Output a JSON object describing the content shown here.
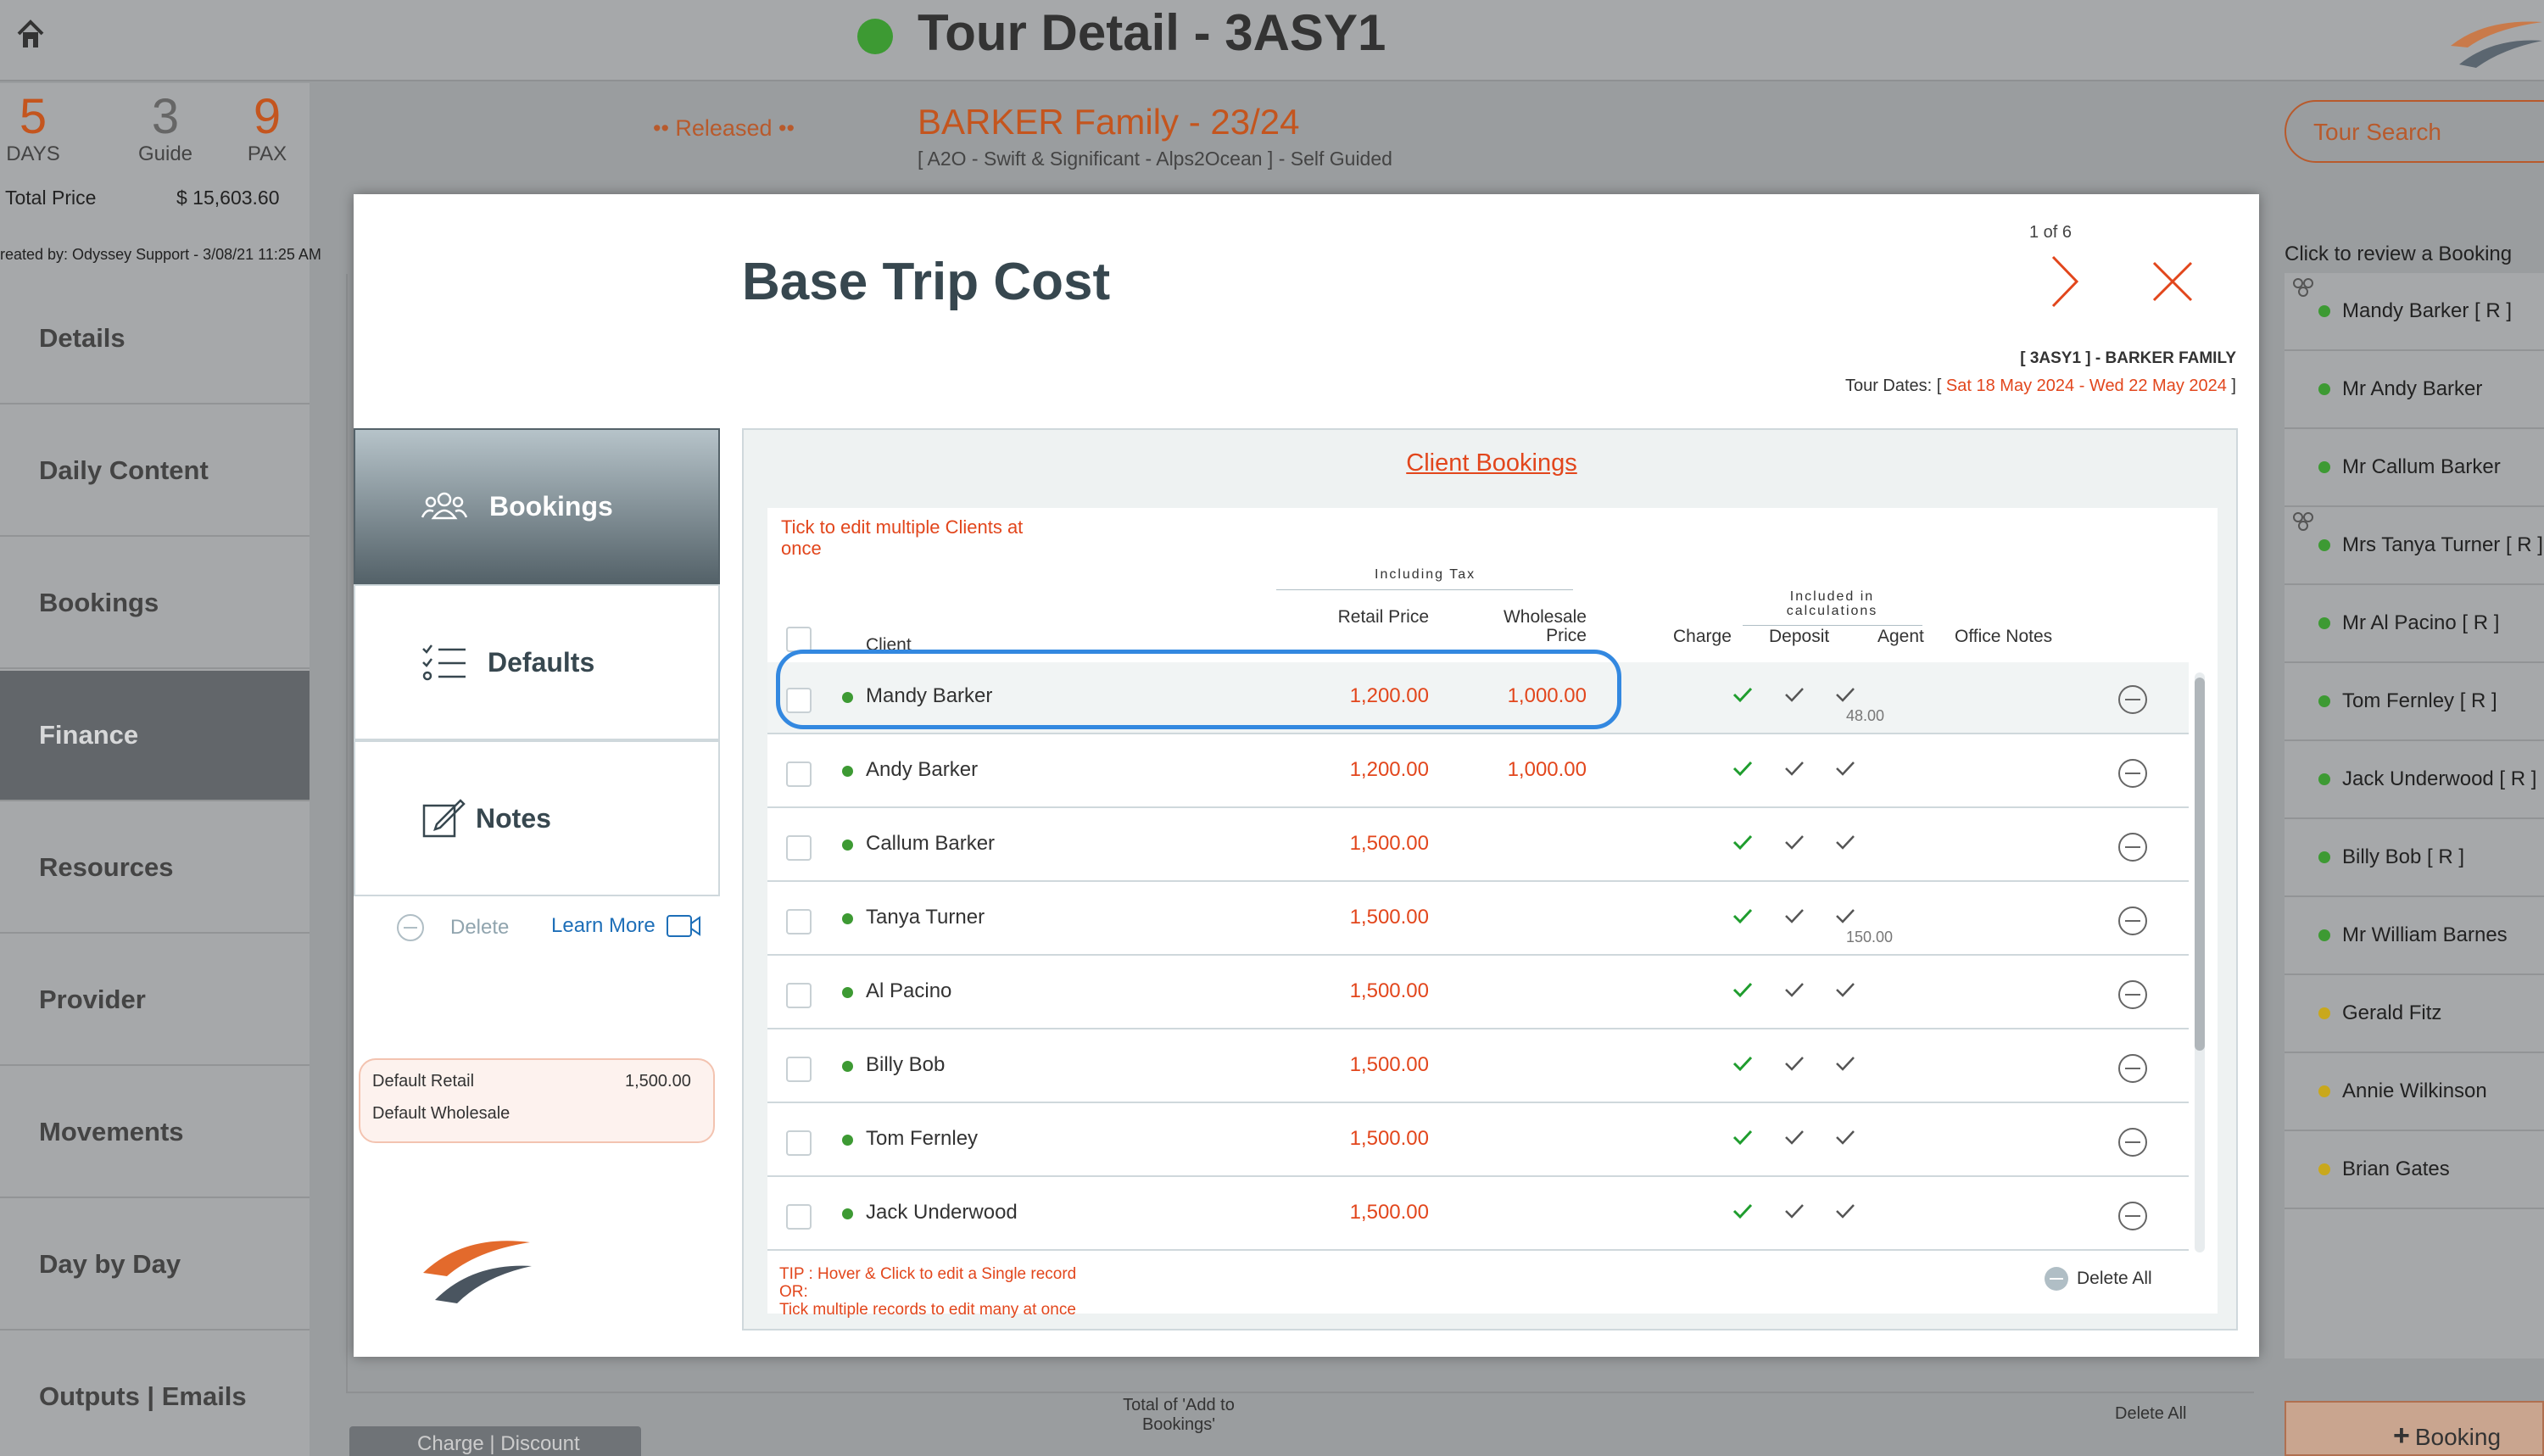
{
  "app": {
    "title": "Tour Detail - 3ASY1",
    "status_dot_color": "#3d9a33"
  },
  "summary": {
    "days": "5",
    "days_label": "DAYS",
    "guide": "3",
    "guide_label": "Guide",
    "pax": "9",
    "pax_label": "PAX",
    "total_price_label": "Total Price",
    "total_price": "$ 15,603.60",
    "created_by": "reated by: Odyssey Support - 3/08/21 11:25 AM"
  },
  "tour": {
    "released": "•• Released ••",
    "name": "BARKER Family - 23/24",
    "subtitle": "[ A2O - Swift & Significant - Alps2Ocean ] - Self Guided"
  },
  "nav": {
    "items": [
      "Details",
      "Daily Content",
      "Bookings",
      "Finance",
      "Resources",
      "Provider",
      "Movements",
      "Day by Day",
      "Outputs | Emails"
    ],
    "active": "Finance"
  },
  "right_panel": {
    "search_label": "Tour Search",
    "review_hint": "Click to review a Booking",
    "bookings": [
      {
        "label": "Mandy Barker  [ R ]",
        "color": "#3d9a33"
      },
      {
        "label": "Mr Andy Barker",
        "color": "#3d9a33"
      },
      {
        "label": "Mr Callum Barker",
        "color": "#3d9a33"
      },
      {
        "label": "Mrs Tanya Turner  [ R ]",
        "color": "#3d9a33"
      },
      {
        "label": "Mr Al Pacino  [ R ]",
        "color": "#3d9a33"
      },
      {
        "label": "Tom Fernley  [ R ]",
        "color": "#3d9a33"
      },
      {
        "label": "Jack Underwood  [ R ]",
        "color": "#3d9a33"
      },
      {
        "label": "Billy Bob  [ R ]",
        "color": "#3d9a33"
      },
      {
        "label": "Mr William Barnes",
        "color": "#3d9a33"
      },
      {
        "label": "Gerald Fitz",
        "color": "#c9a81c"
      },
      {
        "label": "Annie Wilkinson",
        "color": "#c9a81c"
      },
      {
        "label": "Brian Gates",
        "color": "#c9a81c"
      }
    ],
    "add_booking_label": "Booking"
  },
  "background_footer": {
    "total_label": "Total of 'Add to Bookings'",
    "delete_all": "Delete All",
    "charge_button": "Charge | Discount"
  },
  "modal": {
    "title": "Base Trip Cost",
    "pager": "1 of 6",
    "tour_code": "[ 3ASY1 ] - BARKER FAMILY",
    "tour_dates_label": "Tour Dates: [",
    "date_start": "Sat 18 May 2024",
    "date_sep": " - ",
    "date_end": "Wed 22 May 2024",
    "tour_dates_close": " ]",
    "tabs": [
      {
        "label": "Bookings",
        "icon": "people-icon"
      },
      {
        "label": "Defaults",
        "icon": "checklist-icon"
      },
      {
        "label": "Notes",
        "icon": "edit-note-icon"
      }
    ],
    "delete_label": "Delete",
    "learn_more_label": "Learn More",
    "default_retail_label": "Default Retail",
    "default_retail_value": "1,500.00",
    "default_wholesale_label": "Default Wholesale"
  },
  "table": {
    "title": "Client Bookings",
    "tick_hint": "Tick to edit multiple Clients at once",
    "group_tax": "Including Tax",
    "group_calc": "Included in calculations",
    "columns": {
      "client": "Client",
      "retail": "Retail Price",
      "wholesale": "Wholesale Price",
      "charge": "Charge",
      "deposit": "Deposit",
      "agent": "Agent",
      "office_notes": "Office Notes"
    },
    "rows": [
      {
        "name": "Mandy Barker",
        "retail": "1,200.00",
        "wholesale": "1,000.00",
        "agent_note": "48.00"
      },
      {
        "name": "Andy Barker",
        "retail": "1,200.00",
        "wholesale": "1,000.00",
        "agent_note": ""
      },
      {
        "name": "Callum Barker",
        "retail": "1,500.00",
        "wholesale": "",
        "agent_note": ""
      },
      {
        "name": "Tanya Turner",
        "retail": "1,500.00",
        "wholesale": "",
        "agent_note": "150.00"
      },
      {
        "name": "Al Pacino",
        "retail": "1,500.00",
        "wholesale": "",
        "agent_note": ""
      },
      {
        "name": "Billy Bob",
        "retail": "1,500.00",
        "wholesale": "",
        "agent_note": ""
      },
      {
        "name": "Tom Fernley",
        "retail": "1,500.00",
        "wholesale": "",
        "agent_note": ""
      },
      {
        "name": "Jack Underwood",
        "retail": "1,500.00",
        "wholesale": "",
        "agent_note": ""
      }
    ],
    "tip_line1": "TIP : Hover & Click to edit a Single record",
    "tip_line2": "OR:",
    "tip_line3": "Tick multiple records to edit many at once",
    "delete_all": "Delete All"
  },
  "colors": {
    "accent": "#e2461c",
    "charge_check": "#1f9d2e",
    "highlight": "#3388e0"
  }
}
